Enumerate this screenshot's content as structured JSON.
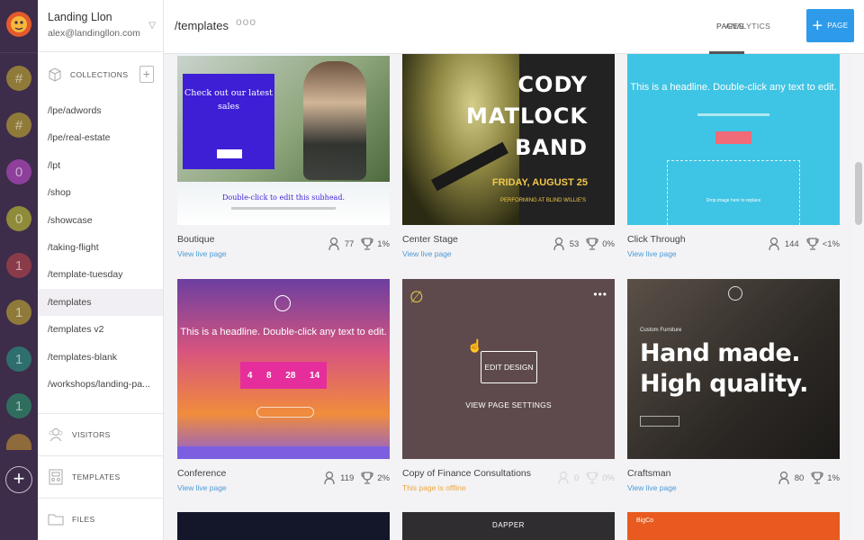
{
  "rail": {
    "items": [
      "#",
      "#",
      "0",
      "0",
      "1",
      "1",
      "1",
      "1"
    ],
    "add_icon": "plus-icon"
  },
  "account": {
    "name": "Landing Llon",
    "email": "alex@landingllon.com"
  },
  "sidebar": {
    "collections_label": "COLLECTIONS",
    "collections": [
      "/lpe/adwords",
      "/lpe/real-estate",
      "/lpt",
      "/shop",
      "/showcase",
      "/taking-flight",
      "/template-tuesday",
      "/templates",
      "/templates v2",
      "/templates-blank",
      "/workshops/landing-pa..."
    ],
    "active_collection": "/templates",
    "sections": [
      "VISITORS",
      "TEMPLATES",
      "FILES"
    ]
  },
  "topbar": {
    "path": "/templates",
    "dots": "ooo",
    "tabs": [
      "PAGES",
      "ANALYTICS"
    ],
    "active_tab": "PAGES",
    "button_label": "PAGE"
  },
  "cards": [
    {
      "title": "Boutique",
      "link": "View live page",
      "visitors": "77",
      "conversion": "1%"
    },
    {
      "title": "Center Stage",
      "link": "View live page",
      "visitors": "53",
      "conversion": "0%"
    },
    {
      "title": "Click Through",
      "link": "View live page",
      "visitors": "144",
      "conversion": "<1%"
    },
    {
      "title": "Conference",
      "link": "View live page",
      "visitors": "119",
      "conversion": "2%"
    },
    {
      "title": "Copy of Finance Consultations",
      "link": "This page is offline",
      "visitors": "0",
      "conversion": "0%"
    },
    {
      "title": "Craftsman",
      "link": "View live page",
      "visitors": "80",
      "conversion": "1%"
    }
  ],
  "thumbs": {
    "boutique": {
      "headline": "Check out our latest sales",
      "subhead": "Double-click to edit this subhead."
    },
    "center_stage": {
      "line1": "CODY",
      "line2": "MATLOCK",
      "line3": "BAND",
      "date": "FRIDAY, AUGUST 25",
      "venue": "PERFORMING AT BLIND WILLIE'S"
    },
    "click_through": {
      "headline": "This is a headline. Double-click any text to edit.",
      "drop": "Drop image here to replace"
    },
    "conference": {
      "headline": "This is a headline. Double-click any text to edit.",
      "timer": [
        "4",
        "8",
        "28",
        "14"
      ]
    },
    "copy": {
      "edit": "EDIT DESIGN",
      "settings": "VIEW PAGE SETTINGS"
    },
    "craftsman": {
      "small": "Custom Furniture",
      "big1": "Hand made.",
      "big2": "High quality."
    },
    "dapper": {
      "brand": "DAPPER"
    },
    "bigco": {
      "brand": "BigCo"
    }
  },
  "colors": {
    "rail": "#3d2c4a",
    "accent": "#2e9bea",
    "link": "#4b9bd9",
    "offline": "#f0a63c"
  }
}
